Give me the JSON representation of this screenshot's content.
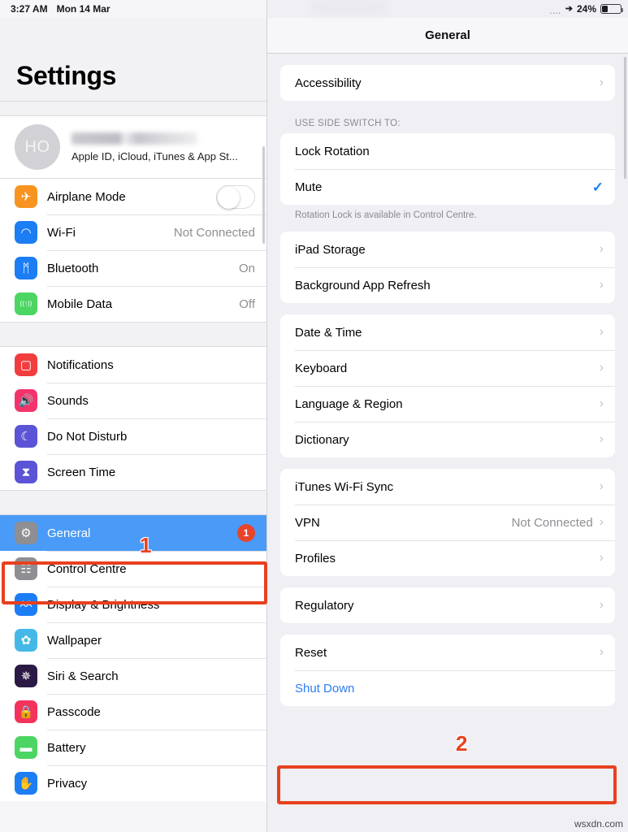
{
  "statusbar": {
    "time": "3:27 AM",
    "date": "Mon 14 Mar",
    "dots": "....",
    "location_icon": "location-arrow-icon",
    "battery_percent": "24%"
  },
  "sidebar": {
    "title": "Settings",
    "account": {
      "initials": "HO",
      "name_redacted": "",
      "subtitle": "Apple ID, iCloud, iTunes & App St..."
    },
    "groups": [
      {
        "items": [
          {
            "label": "Airplane Mode",
            "icon": "airplane-icon",
            "icon_color": "#f79421",
            "glyph": "✈",
            "control": "toggle",
            "value": ""
          },
          {
            "label": "Wi-Fi",
            "icon": "wifi-icon",
            "icon_color": "#1c7df5",
            "glyph": "◠",
            "control": "value",
            "value": "Not Connected"
          },
          {
            "label": "Bluetooth",
            "icon": "bluetooth-icon",
            "icon_color": "#1c7df5",
            "glyph": "ᛗ",
            "control": "value",
            "value": "On"
          },
          {
            "label": "Mobile Data",
            "icon": "mobile-data-icon",
            "icon_color": "#4cd562",
            "glyph": "((↑))",
            "control": "value",
            "value": "Off"
          }
        ]
      },
      {
        "items": [
          {
            "label": "Notifications",
            "icon": "notifications-icon",
            "icon_color": "#f13d3d",
            "glyph": "▢",
            "control": "none",
            "value": ""
          },
          {
            "label": "Sounds",
            "icon": "sounds-icon",
            "icon_color": "#f4336a",
            "glyph": "🔊",
            "control": "none",
            "value": ""
          },
          {
            "label": "Do Not Disturb",
            "icon": "do-not-disturb-icon",
            "icon_color": "#5b54d6",
            "glyph": "☾",
            "control": "none",
            "value": ""
          },
          {
            "label": "Screen Time",
            "icon": "screen-time-icon",
            "icon_color": "#5b54d6",
            "glyph": "⧗",
            "control": "none",
            "value": ""
          }
        ]
      },
      {
        "items": [
          {
            "label": "General",
            "icon": "gear-icon",
            "icon_color": "#8e8e93",
            "glyph": "⚙",
            "control": "badge",
            "value": "1",
            "selected": true
          },
          {
            "label": "Control Centre",
            "icon": "control-centre-icon",
            "icon_color": "#8e8e93",
            "glyph": "☷",
            "control": "none",
            "value": ""
          },
          {
            "label": "Display & Brightness",
            "icon": "display-brightness-icon",
            "icon_color": "#1c7df5",
            "glyph": "AA",
            "control": "none",
            "value": ""
          },
          {
            "label": "Wallpaper",
            "icon": "wallpaper-icon",
            "icon_color": "#46b8e8",
            "glyph": "✿",
            "control": "none",
            "value": ""
          },
          {
            "label": "Siri & Search",
            "icon": "siri-search-icon",
            "icon_color": "#2b1a45",
            "glyph": "✵",
            "control": "none",
            "value": ""
          },
          {
            "label": "Passcode",
            "icon": "passcode-icon",
            "icon_color": "#f4335c",
            "glyph": "🔒",
            "control": "none",
            "value": ""
          },
          {
            "label": "Battery",
            "icon": "battery-icon",
            "icon_color": "#4cd562",
            "glyph": "▬",
            "control": "none",
            "value": ""
          },
          {
            "label": "Privacy",
            "icon": "privacy-icon",
            "icon_color": "#1c7df5",
            "glyph": "✋",
            "control": "none",
            "value": ""
          }
        ]
      }
    ]
  },
  "detail": {
    "nav_title": "General",
    "groups": [
      {
        "header": "",
        "footer": "",
        "rows": [
          {
            "label": "Accessibility",
            "value": "",
            "accessory": "chevron"
          }
        ]
      },
      {
        "header": "USE SIDE SWITCH TO:",
        "footer": "Rotation Lock is available in Control Centre.",
        "rows": [
          {
            "label": "Lock Rotation",
            "value": "",
            "accessory": "none"
          },
          {
            "label": "Mute",
            "value": "",
            "accessory": "check"
          }
        ]
      },
      {
        "header": "",
        "footer": "",
        "rows": [
          {
            "label": "iPad Storage",
            "value": "",
            "accessory": "chevron"
          },
          {
            "label": "Background App Refresh",
            "value": "",
            "accessory": "chevron"
          }
        ]
      },
      {
        "header": "",
        "footer": "",
        "rows": [
          {
            "label": "Date & Time",
            "value": "",
            "accessory": "chevron"
          },
          {
            "label": "Keyboard",
            "value": "",
            "accessory": "chevron"
          },
          {
            "label": "Language & Region",
            "value": "",
            "accessory": "chevron"
          },
          {
            "label": "Dictionary",
            "value": "",
            "accessory": "chevron"
          }
        ]
      },
      {
        "header": "",
        "footer": "",
        "rows": [
          {
            "label": "iTunes Wi-Fi Sync",
            "value": "",
            "accessory": "chevron"
          },
          {
            "label": "VPN",
            "value": "Not Connected",
            "accessory": "chevron"
          },
          {
            "label": "Profiles",
            "value": "",
            "accessory": "chevron"
          }
        ]
      },
      {
        "header": "",
        "footer": "",
        "rows": [
          {
            "label": "Regulatory",
            "value": "",
            "accessory": "chevron"
          }
        ]
      },
      {
        "header": "",
        "footer": "",
        "rows": [
          {
            "label": "Reset",
            "value": "",
            "accessory": "chevron"
          },
          {
            "label": "Shut Down",
            "value": "",
            "accessory": "none",
            "link": true
          }
        ]
      }
    ]
  },
  "annotations": [
    {
      "number": "1",
      "target": "general-sidebar-row"
    },
    {
      "number": "2",
      "target": "shut-down-row"
    }
  ],
  "watermark": "wsxdn.com",
  "colors": {
    "accent_blue": "#4a9bf7",
    "link_blue": "#2c7cf6",
    "annotation_red": "#e8401f",
    "badge_red": "#e8442a",
    "check_blue": "#1d7ef3"
  }
}
